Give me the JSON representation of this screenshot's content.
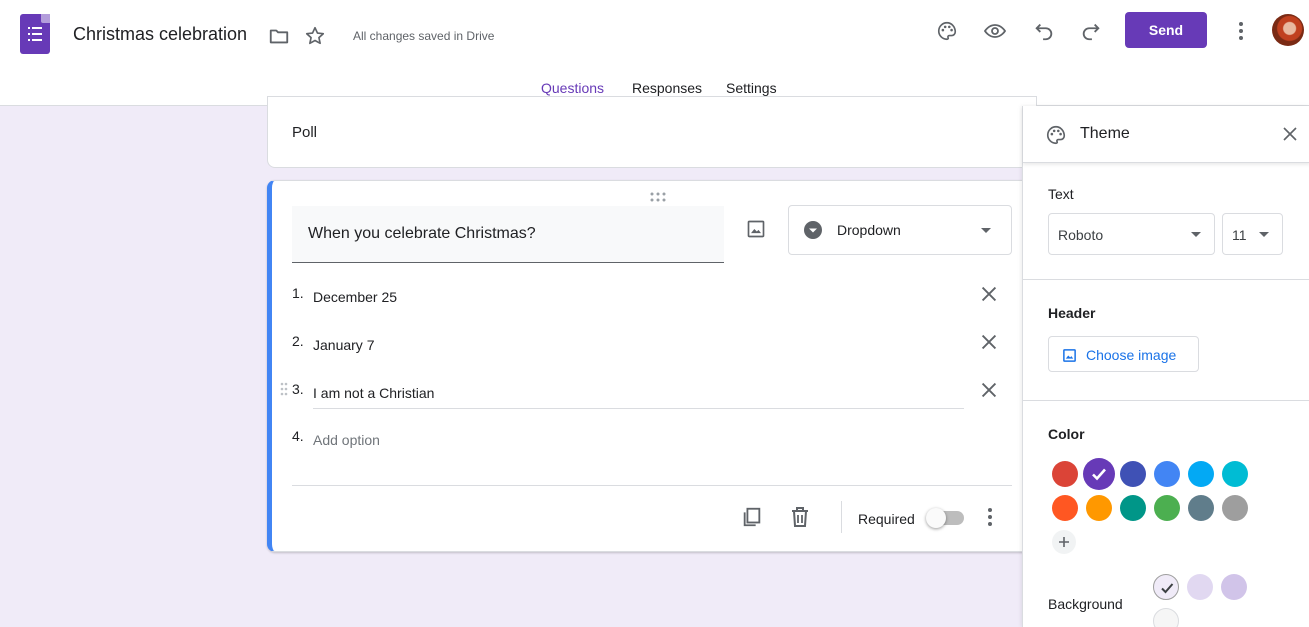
{
  "header": {
    "doc_title": "Christmas celebration",
    "save_status": "All changes saved in Drive",
    "send_label": "Send",
    "icons": [
      "forms-logo-icon",
      "folder-icon",
      "star-icon",
      "palette-icon",
      "eye-icon",
      "undo-icon",
      "redo-icon",
      "more-vert-icon",
      "avatar"
    ]
  },
  "tabs": [
    {
      "label": "Questions",
      "active": true
    },
    {
      "label": "Responses",
      "active": false
    },
    {
      "label": "Settings",
      "active": false
    }
  ],
  "poll_card": {
    "text": "Poll"
  },
  "question": {
    "text": "When you celebrate Christmas?",
    "type_label": "Dropdown",
    "options": [
      {
        "num": "1.",
        "text": "December 25"
      },
      {
        "num": "2.",
        "text": "January 7"
      },
      {
        "num": "3.",
        "text": "I am not a Christian"
      },
      {
        "num": "4.",
        "text": "Add option"
      }
    ],
    "required_label": "Required",
    "required": false
  },
  "theme": {
    "title": "Theme",
    "text_label": "Text",
    "font_value": "Roboto",
    "size_value": "11",
    "header_label": "Header",
    "choose_image_label": "Choose image",
    "color_label": "Color",
    "background_label": "Background",
    "colors": [
      "#db4437",
      "#673ab7",
      "#3f51b5",
      "#4285f4",
      "#03a9f4",
      "#00bcd4",
      "#ff5722",
      "#ff9800",
      "#009688",
      "#4caf50",
      "#607d8b",
      "#9e9e9e"
    ],
    "selected_color": "#673ab7",
    "backgrounds": [
      "#f0ebf8",
      "#e1d8f1",
      "#d1c4e9",
      "#f6f6f6"
    ]
  }
}
